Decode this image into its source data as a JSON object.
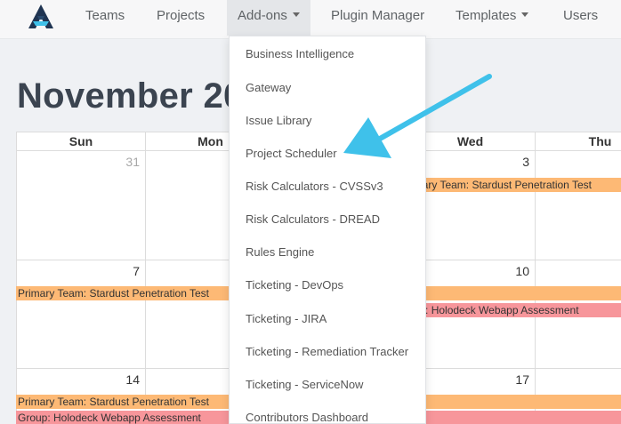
{
  "nav": {
    "items": [
      {
        "label": "Teams"
      },
      {
        "label": "Projects"
      },
      {
        "label": "Add-ons"
      },
      {
        "label": "Plugin Manager"
      },
      {
        "label": "Templates"
      },
      {
        "label": "Users"
      }
    ]
  },
  "calendar": {
    "month_title": "November 20",
    "weekdays": [
      "Sun",
      "Mon",
      "Wed",
      "Thu"
    ],
    "weeks": [
      {
        "days": [
          "31",
          "3"
        ]
      },
      {
        "days": [
          "7",
          "10"
        ]
      },
      {
        "days": [
          "14",
          "17"
        ]
      }
    ],
    "events": {
      "e1": "rimary Team: Stardust Penetration Test",
      "e2": "Primary Team: Stardust Penetration Test",
      "e3": "oup: Holodeck Webapp Assessment",
      "e4": "Primary Team: Stardust Penetration Test",
      "e5": "Group: Holodeck Webapp Assessment"
    },
    "colors": {
      "primary_team": "#fdb975",
      "group": "#f7969b"
    }
  },
  "addons_menu": {
    "items": [
      {
        "label": "Business Intelligence"
      },
      {
        "label": "Gateway"
      },
      {
        "label": "Issue Library"
      },
      {
        "label": "Project Scheduler"
      },
      {
        "label": "Risk Calculators - CVSSv3"
      },
      {
        "label": "Risk Calculators - DREAD"
      },
      {
        "label": "Rules Engine"
      },
      {
        "label": "Ticketing - DevOps"
      },
      {
        "label": "Ticketing - JIRA"
      },
      {
        "label": "Ticketing - Remediation Tracker"
      },
      {
        "label": "Ticketing - ServiceNow"
      },
      {
        "label": "Contributors Dashboard"
      }
    ]
  },
  "annotation": {
    "arrow_color": "#3fc1ea",
    "points_to": "Project Scheduler"
  }
}
